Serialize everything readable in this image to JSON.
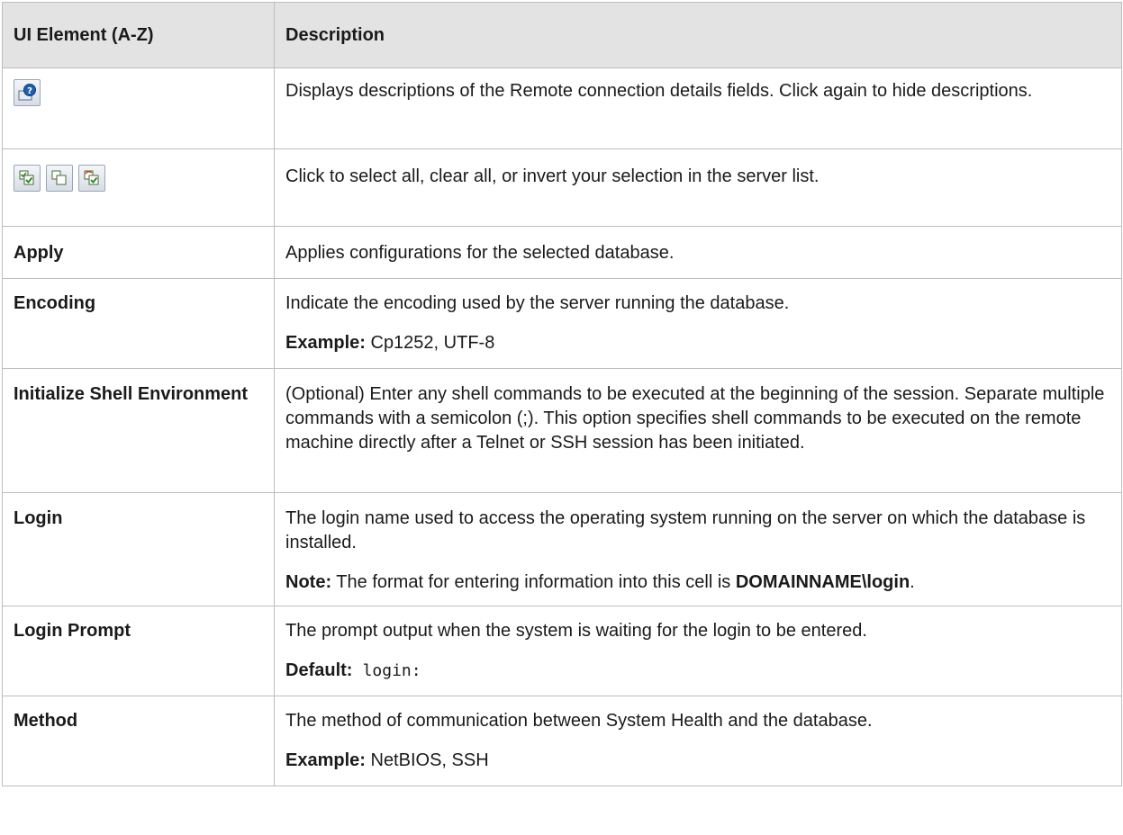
{
  "table": {
    "headers": [
      "UI Element (A-Z)",
      "Description"
    ],
    "icons": {
      "help": "help-descriptions-icon",
      "select_all": "select-all-icon",
      "clear_all": "clear-all-icon",
      "invert": "invert-selection-icon"
    },
    "rows": [
      {
        "name": "",
        "p1": "Displays descriptions of the Remote connection details fields. Click again to hide descriptions."
      },
      {
        "name": "",
        "p1": "Click to select all, clear all, or invert your selection in the server list."
      },
      {
        "name": "Apply",
        "p1": "Applies configurations for the selected database."
      },
      {
        "name": "Encoding",
        "p1": "Indicate the encoding used by the server running the database.",
        "p2_label": "Example:",
        "p2_text": " Cp1252, UTF-8"
      },
      {
        "name": "Initialize Shell Environment",
        "p1": "(Optional) Enter any shell commands to be executed at the beginning of the session. Separate multiple commands with a semicolon (;). This option specifies shell commands to be executed on the remote machine directly after a Telnet or SSH session has been initiated."
      },
      {
        "name": "Login",
        "p1": "The login name used to access the operating system running on the server on which the database is installed.",
        "p2_label": "Note:",
        "p2_text": " The format for entering information into this cell is ",
        "p2_bold": "DOMAINNAME\\login",
        "p2_end": "."
      },
      {
        "name": "Login Prompt",
        "p1": "The prompt output when the system is waiting for the login to be entered.",
        "p2_label": "Default:",
        "p2_code": "login:"
      },
      {
        "name": "Method",
        "p1": "The method of communication between System Health and the database.",
        "p2_label": "Example:",
        "p2_text": " NetBIOS, SSH"
      }
    ]
  }
}
